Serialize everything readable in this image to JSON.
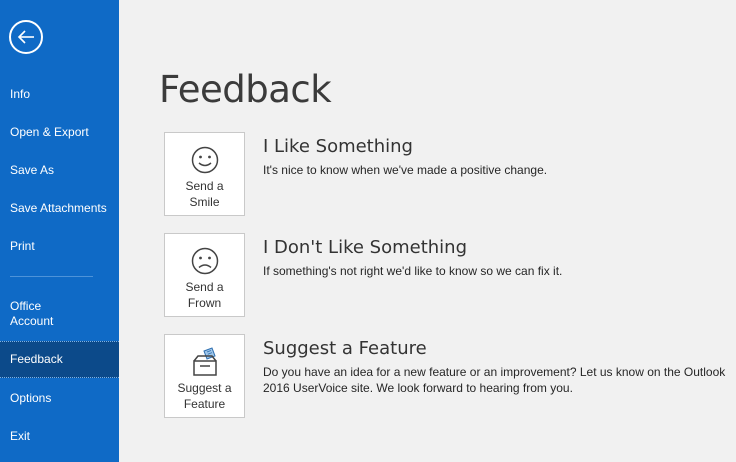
{
  "sidebar": {
    "back_icon": "back-arrow-icon",
    "items": [
      {
        "label": "Info"
      },
      {
        "label": "Open & Export"
      },
      {
        "label": "Save As"
      },
      {
        "label": "Save Attachments"
      },
      {
        "label": "Print"
      },
      {
        "label": "Office\nAccount"
      },
      {
        "label": "Feedback",
        "selected": true
      },
      {
        "label": "Options"
      },
      {
        "label": "Exit"
      }
    ],
    "colors": {
      "background": "#0f6ac6",
      "selected": "#0c4a8a"
    }
  },
  "main": {
    "title": "Feedback",
    "options": [
      {
        "icon": "smile-icon",
        "tile_label": "Send a\nSmile",
        "title": "I Like Something",
        "description": "It's nice to know when we've made a positive change."
      },
      {
        "icon": "frown-icon",
        "tile_label": "Send a\nFrown",
        "title": "I Don't Like Something",
        "description": "If something's not right we'd like to know so we can fix it."
      },
      {
        "icon": "suggestion-box-icon",
        "tile_label": "Suggest a\nFeature",
        "title": "Suggest a Feature",
        "description": "Do you have an idea for a new feature or an improvement? Let us know on the Outlook 2016 UserVoice site. We look forward to hearing from you."
      }
    ]
  }
}
